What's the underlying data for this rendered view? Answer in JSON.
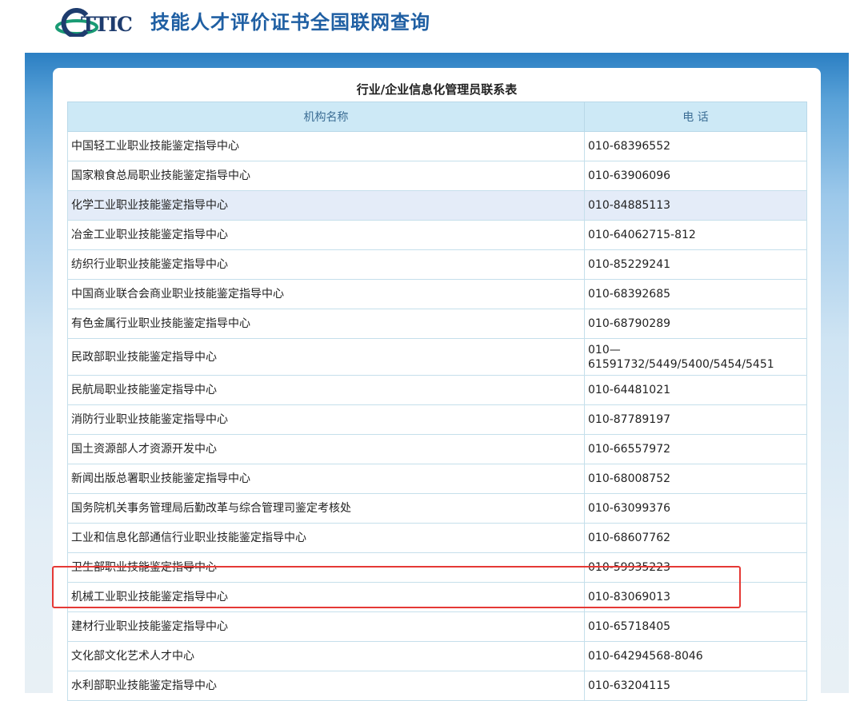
{
  "header": {
    "logo_text": "ETTIC",
    "title": "技能人才评价证书全国联网查询",
    "brand_colors": {
      "logo_green": "#1a9b74",
      "logo_navy": "#1e3c6e",
      "title_blue": "#1f5fa3"
    }
  },
  "table": {
    "caption": "行业/企业信息化管理员联系表",
    "columns": [
      "机构名称",
      "电 话"
    ],
    "rows": [
      {
        "name": "中国轻工业职业技能鉴定指导中心",
        "phone": "010-68396552"
      },
      {
        "name": "国家粮食总局职业技能鉴定指导中心",
        "phone": "010-63906096"
      },
      {
        "name": "化学工业职业技能鉴定指导中心",
        "phone": "010-84885113"
      },
      {
        "name": "冶金工业职业技能鉴定指导中心",
        "phone": "010-64062715-812"
      },
      {
        "name": "纺织行业职业技能鉴定指导中心",
        "phone": "010-85229241"
      },
      {
        "name": "中国商业联合会商业职业技能鉴定指导中心",
        "phone": "010-68392685"
      },
      {
        "name": "有色金属行业职业技能鉴定指导中心",
        "phone": "010-68790289"
      },
      {
        "name": "民政部职业技能鉴定指导中心",
        "phone": "010—61591732/5449/5400/5454/5451"
      },
      {
        "name": "民航局职业技能鉴定指导中心",
        "phone": "010-64481021"
      },
      {
        "name": "消防行业职业技能鉴定指导中心",
        "phone": "010-87789197"
      },
      {
        "name": "国土资源部人才资源开发中心",
        "phone": "010-66557972"
      },
      {
        "name": "新闻出版总署职业技能鉴定指导中心",
        "phone": "010-68008752"
      },
      {
        "name": "国务院机关事务管理局后勤改革与综合管理司鉴定考核处",
        "phone": "010-63099376"
      },
      {
        "name": "工业和信息化部通信行业职业技能鉴定指导中心",
        "phone": "010-68607762"
      },
      {
        "name": "卫生部职业技能鉴定指导中心",
        "phone": "010-59935223"
      },
      {
        "name": "机械工业职业技能鉴定指导中心",
        "phone": "010-83069013"
      },
      {
        "name": "建材行业职业技能鉴定指导中心",
        "phone": "010-65718405"
      },
      {
        "name": "文化部文化艺术人才中心",
        "phone": "010-64294568-8046"
      },
      {
        "name": "水利部职业技能鉴定指导中心",
        "phone": "010-63204115"
      }
    ],
    "highlighted_row_index": 2,
    "marked_row_index": 15,
    "colors": {
      "header_bg": "#cde9f6",
      "row_highlight": "#e4ecf8",
      "annotation_red": "#e53935"
    }
  }
}
